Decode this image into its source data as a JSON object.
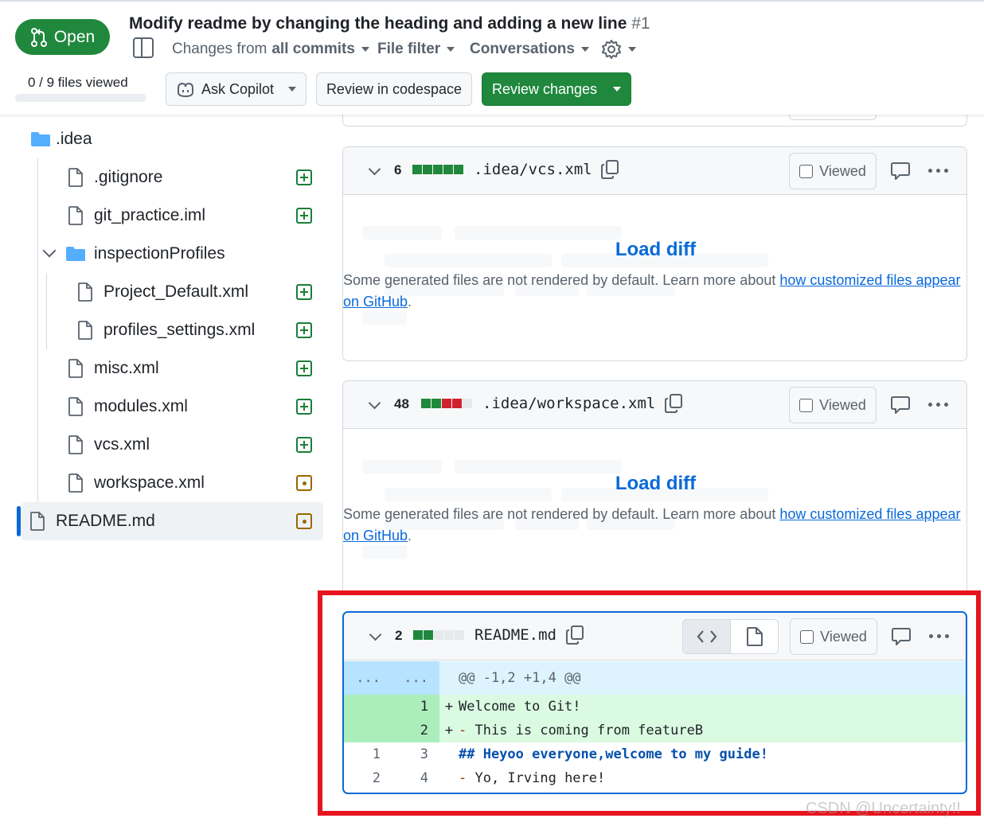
{
  "header": {
    "status": "Open",
    "title": "Modify readme by changing the heading and adding a new line",
    "number": "#1",
    "changes_from_prefix": "Changes from",
    "changes_from_value": "all commits",
    "file_filter": "File filter",
    "conversations": "Conversations",
    "files_viewed": "0 / 9 files viewed",
    "ask_copilot": "Ask Copilot",
    "review_codespace": "Review in codespace",
    "review_changes": "Review changes"
  },
  "tree": {
    "items": [
      {
        "label": ".idea",
        "type": "folder"
      },
      {
        "label": ".gitignore",
        "status": "added"
      },
      {
        "label": "git_practice.iml",
        "status": "added"
      },
      {
        "label": "inspectionProfiles",
        "type": "folder"
      },
      {
        "label": "Project_Default.xml",
        "status": "added"
      },
      {
        "label": "profiles_settings.xml",
        "status": "added"
      },
      {
        "label": "misc.xml",
        "status": "added"
      },
      {
        "label": "modules.xml",
        "status": "added"
      },
      {
        "label": "vcs.xml",
        "status": "added"
      },
      {
        "label": "workspace.xml",
        "status": "modified"
      },
      {
        "label": "README.md",
        "status": "modified",
        "selected": true
      }
    ]
  },
  "files": [
    {
      "count": "6",
      "blocks": [
        "g",
        "g",
        "g",
        "g",
        "g"
      ],
      "name": ".idea/vcs.xml",
      "viewed": "Viewed",
      "load_diff": "Load diff",
      "note": "Some generated files are not rendered by default. Learn more about",
      "link": "how customized files appear on GitHub",
      "note_end": "."
    },
    {
      "count": "48",
      "blocks": [
        "g",
        "g",
        "r",
        "r",
        "n"
      ],
      "name": ".idea/workspace.xml",
      "viewed": "Viewed",
      "load_diff": "Load diff",
      "note": "Some generated files are not rendered by default. Learn more about",
      "link": "how customized files appear on GitHub",
      "note_end": "."
    },
    {
      "count": "2",
      "blocks": [
        "g",
        "g",
        "n",
        "n",
        "n"
      ],
      "name": "README.md",
      "viewed": "Viewed",
      "hunk": {
        "left": "...",
        "right": "...",
        "header": "@@ -1,2 +1,4 @@"
      },
      "lines": [
        {
          "old": "",
          "new": "1",
          "sign": "+",
          "code": "Welcome to Git!"
        },
        {
          "old": "",
          "new": "2",
          "sign": "+",
          "marker": "-",
          "code": " This is coming from featureB"
        },
        {
          "old": "1",
          "new": "3",
          "sign": "",
          "code": "## Heyoo everyone,welcome to my guide!"
        },
        {
          "old": "2",
          "new": "4",
          "sign": "",
          "marker": "-",
          "code": " Yo, Irving here!"
        }
      ]
    }
  ],
  "watermark": "CSDN @Uncertainty!!"
}
